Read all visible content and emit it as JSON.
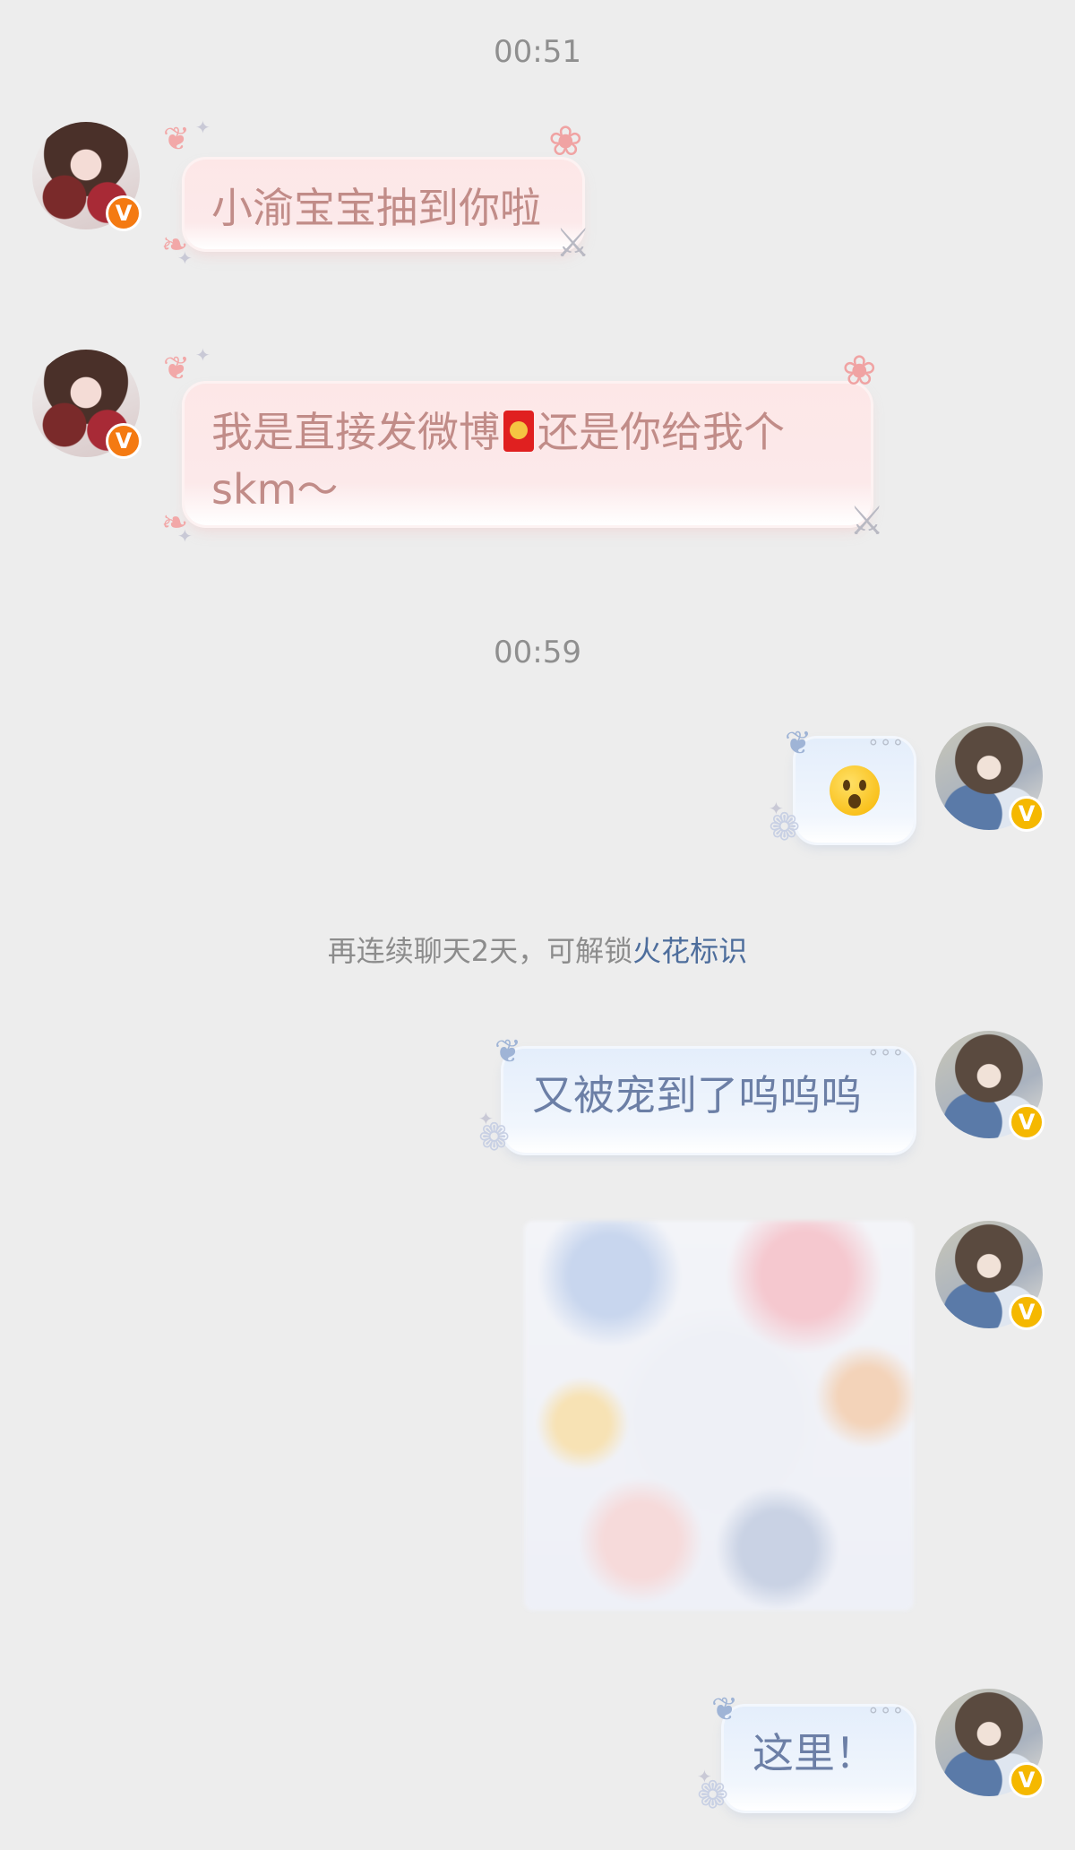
{
  "messages": {
    "timestamp_1": "00:51",
    "msg_1": "小渝宝宝抽到你啦",
    "msg_2_part1": "我是直接发微博",
    "msg_2_part2": "还是你给我个",
    "msg_2_part3": "skm～",
    "timestamp_2": "00:59",
    "msg_4": "又被宠到了呜呜呜",
    "msg_6": "这里！"
  },
  "system_notice": {
    "text": "再连续聊天2天，可解锁",
    "link": "火花标识"
  },
  "avatars": {
    "left_badge": "V",
    "right_badge": "V"
  },
  "icons": {
    "badge_left_color": "#f47a12",
    "badge_right_color": "#f5b800",
    "red_packet": "red-packet-icon",
    "emoji": "hushed-face-emoji"
  }
}
